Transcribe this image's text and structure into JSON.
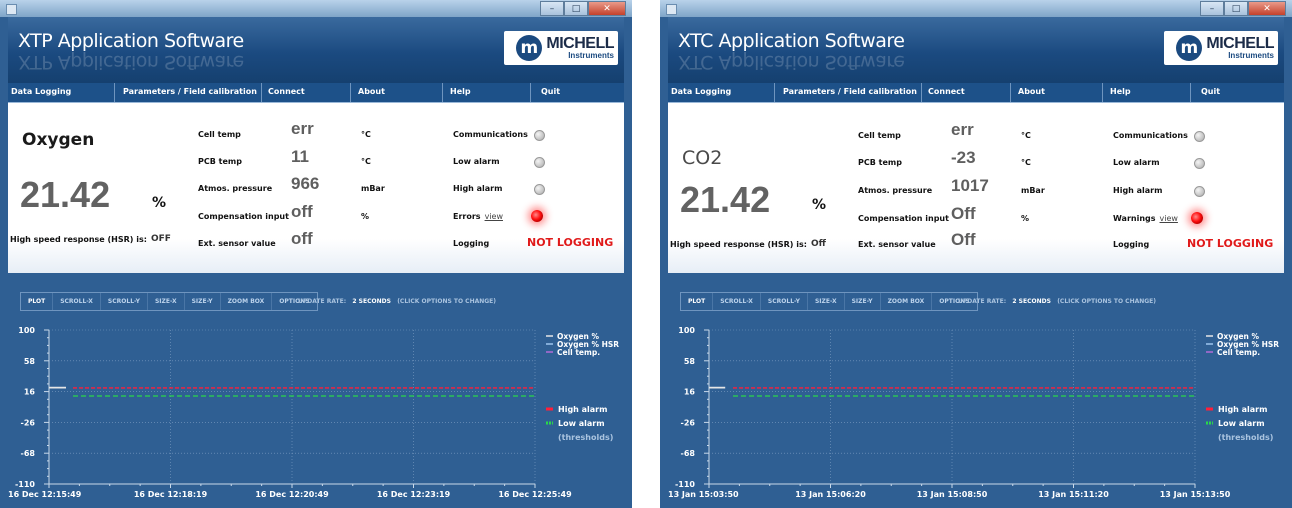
{
  "windows": [
    {
      "app_title": "XTP Application Software",
      "logo": {
        "main": "MICHELL",
        "sub": "Instruments",
        "mark": "m"
      },
      "menu": [
        "Data Logging",
        "Parameters / Field calibration",
        "Connect",
        "About",
        "Help",
        "Quit"
      ],
      "gas_label": "Oxygen",
      "reading": "21.42",
      "reading_unit": "%",
      "hsr_label": "High speed response (HSR) is:",
      "hsr_value": "OFF",
      "params": [
        {
          "label": "Cell temp",
          "value": "err",
          "unit": "°C"
        },
        {
          "label": "PCB temp",
          "value": "11",
          "unit": "°C"
        },
        {
          "label": "Atmos. pressure",
          "value": "966",
          "unit": "mBar"
        },
        {
          "label": "Compensation input",
          "value": "off",
          "unit": "%"
        },
        {
          "label": "Ext. sensor value",
          "value": "off",
          "unit": ""
        }
      ],
      "status": [
        {
          "label": "Communications",
          "led": "grey"
        },
        {
          "label": "Low alarm",
          "led": "grey"
        },
        {
          "label": "High alarm",
          "led": "grey"
        },
        {
          "label": "Errors",
          "link": "view",
          "led": "red"
        },
        {
          "label": "Logging",
          "text": "NOT LOGGING"
        }
      ],
      "plot_controls": [
        "PLOT",
        "SCROLL-X",
        "SCROLL-Y",
        "SIZE-X",
        "SIZE-Y",
        "ZOOM BOX",
        "OPTIONS"
      ],
      "update_rate": {
        "label": "UPDATE RATE:",
        "value": "2 SECONDS",
        "hint": "(CLICK OPTIONS TO CHANGE)"
      },
      "chart_data": {
        "type": "line",
        "yticks": [
          100,
          58,
          16,
          -26,
          -68,
          -110
        ],
        "ylim": [
          -110,
          100
        ],
        "xticks": [
          "16 Dec 12:15:49",
          "16 Dec 12:18:19",
          "16 Dec 12:20:49",
          "16 Dec 12:23:19",
          "16 Dec 12:25:49"
        ],
        "series": [
          {
            "name": "Oxygen %",
            "color": "#e6e6e6",
            "x": [
              "16 Dec 12:15:49",
              "16 Dec 12:16:10"
            ],
            "values": [
              21.42,
              21.42
            ]
          },
          {
            "name": "Oxygen % HSR",
            "color": "#9fc6ef",
            "values": []
          },
          {
            "name": "Cell temp.",
            "color": "#b36bd6",
            "values": []
          }
        ],
        "thresholds": [
          {
            "name": "High alarm",
            "value": 21,
            "color": "#ff1f3a"
          },
          {
            "name": "Low alarm",
            "value": 10,
            "color": "#2ad84a"
          }
        ],
        "thresholds_note": "(thresholds)"
      }
    },
    {
      "app_title": "XTC Application Software",
      "logo": {
        "main": "MICHELL",
        "sub": "Instruments",
        "mark": "m"
      },
      "menu": [
        "Data Logging",
        "Parameters / Field calibration",
        "Connect",
        "About",
        "Help",
        "Quit"
      ],
      "gas_label": "CO2",
      "reading": "21.42",
      "reading_unit": "%",
      "hsr_label": "High speed response (HSR) is:",
      "hsr_value": "Off",
      "params": [
        {
          "label": "Cell temp",
          "value": "err",
          "unit": "°C"
        },
        {
          "label": "PCB temp",
          "value": "-23",
          "unit": "°C"
        },
        {
          "label": "Atmos. pressure",
          "value": "1017",
          "unit": "mBar"
        },
        {
          "label": "Compensation input",
          "value": "Off",
          "unit": "%"
        },
        {
          "label": "Ext. sensor value",
          "value": "Off",
          "unit": ""
        }
      ],
      "status": [
        {
          "label": "Communications",
          "led": "grey"
        },
        {
          "label": "Low alarm",
          "led": "grey"
        },
        {
          "label": "High alarm",
          "led": "grey"
        },
        {
          "label": "Warnings",
          "link": "view",
          "led": "red"
        },
        {
          "label": "Logging",
          "text": "NOT LOGGING"
        }
      ],
      "plot_controls": [
        "PLOT",
        "SCROLL-X",
        "SCROLL-Y",
        "SIZE-X",
        "SIZE-Y",
        "ZOOM BOX",
        "OPTIONS"
      ],
      "update_rate": {
        "label": "UPDATE RATE:",
        "value": "2 SECONDS",
        "hint": "(CLICK OPTIONS TO CHANGE)"
      },
      "chart_data": {
        "type": "line",
        "yticks": [
          100,
          58,
          16,
          -26,
          -68,
          -110
        ],
        "ylim": [
          -110,
          100
        ],
        "xticks": [
          "13 Jan 15:03:50",
          "13 Jan 15:06:20",
          "13 Jan 15:08:50",
          "13 Jan 15:11:20",
          "13 Jan 15:13:50"
        ],
        "series": [
          {
            "name": "Oxygen %",
            "color": "#e6e6e6",
            "x": [
              "13 Jan 15:03:50",
              "13 Jan 15:04:10"
            ],
            "values": [
              21.42,
              21.42
            ]
          },
          {
            "name": "Oxygen % HSR",
            "color": "#9fc6ef",
            "values": []
          },
          {
            "name": "Cell temp.",
            "color": "#b36bd6",
            "values": []
          }
        ],
        "thresholds": [
          {
            "name": "High alarm",
            "value": 21,
            "color": "#ff1f3a"
          },
          {
            "name": "Low alarm",
            "value": 10,
            "color": "#2ad84a"
          }
        ],
        "thresholds_note": "(thresholds)"
      }
    }
  ]
}
